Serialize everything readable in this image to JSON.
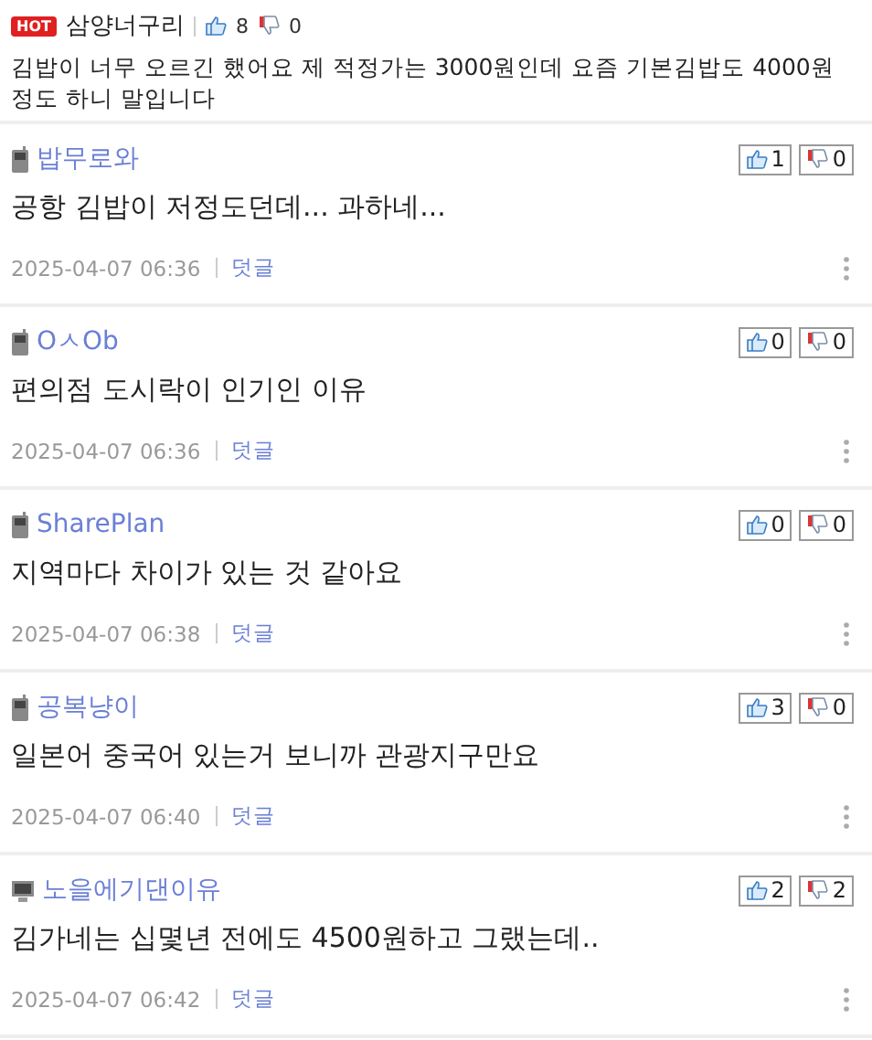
{
  "post": {
    "badge": "HOT",
    "author": "삼양너구리",
    "likes": "8",
    "dislikes": "0",
    "body": "김밥이 너무 오르긴 했어요 제 적정가는 3000원인데 요즘 기본김밥도 4000원정도 하니 말입니다"
  },
  "comments": [
    {
      "kind": "mobile",
      "author": "밥무로와",
      "likes": "1",
      "dislikes": "0",
      "body": "공항 김밥이 저정도던데... 과하네...",
      "date": "2025-04-07 06:36",
      "reply": "덧글"
    },
    {
      "kind": "mobile",
      "author": "OㅅOb",
      "likes": "0",
      "dislikes": "0",
      "body": "편의점 도시락이 인기인 이유",
      "date": "2025-04-07 06:36",
      "reply": "덧글"
    },
    {
      "kind": "mobile",
      "author": "SharePlan",
      "likes": "0",
      "dislikes": "0",
      "body": "지역마다 차이가 있는 것 같아요",
      "date": "2025-04-07 06:38",
      "reply": "덧글"
    },
    {
      "kind": "mobile",
      "author": "공복냥이",
      "likes": "3",
      "dislikes": "0",
      "body": "일본어 중국어 있는거 보니까 관광지구만요",
      "date": "2025-04-07 06:40",
      "reply": "덧글"
    },
    {
      "kind": "pc",
      "author": "노을에기댄이유",
      "likes": "2",
      "dislikes": "2",
      "body": "김가네는 십몇년 전에도 4500원하고 그랬는데..",
      "date": "2025-04-07 06:42",
      "reply": "덧글"
    }
  ]
}
